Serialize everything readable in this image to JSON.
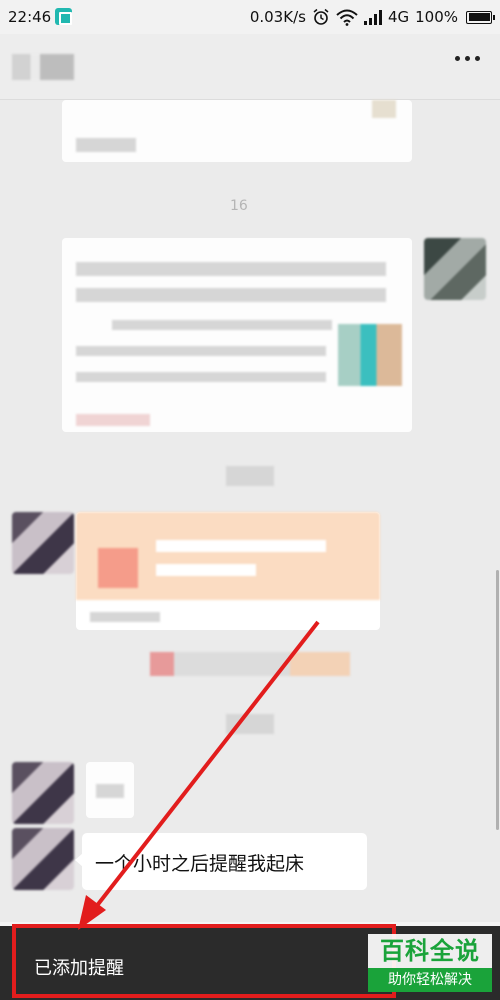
{
  "status_bar": {
    "time": "22:46",
    "network_speed": "0.03K/s",
    "network_type": "4G",
    "battery": "100%",
    "icons": [
      "scan-app-icon",
      "alarm-icon",
      "wifi-icon",
      "signal-icon",
      "battery-icon"
    ]
  },
  "title_bar": {
    "more_icon": "more-dots-icon"
  },
  "chat": {
    "time_label_1": "16",
    "last_message": "一个小时之后提醒我起床"
  },
  "toast": {
    "text": "已添加提醒"
  },
  "watermark": {
    "main": "百科全说",
    "sub": "助你轻松解决"
  },
  "colors": {
    "highlight": "#e21d1d",
    "toast_bg": "#2b2b2b",
    "watermark_green": "#1aa33a"
  }
}
